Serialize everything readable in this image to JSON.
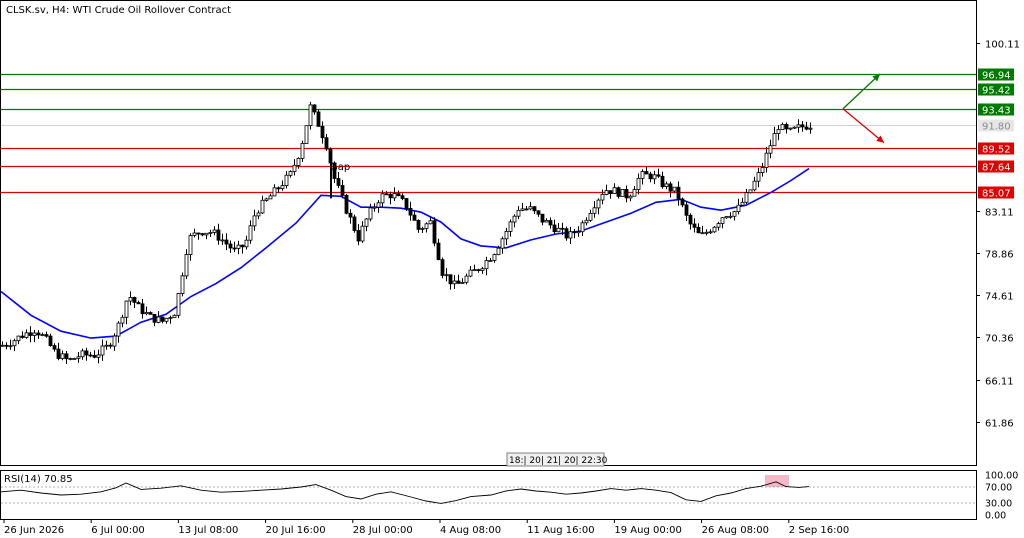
{
  "header": {
    "title": "CLSK.sv, H4:  WTI Crude Oil Rollover Contract"
  },
  "colors": {
    "candle": "#000000",
    "ma": "#0000ff",
    "resistance": "#007a00",
    "support": "#e00000",
    "current_price": "#c0c0c0",
    "rsi_line": "#000000",
    "rsi_highlight": "#f4a6b8"
  },
  "annotations": {
    "gap_label": "Gap"
  },
  "scroll_label": "18:| 20| 21| 20| 22:30",
  "chart_data": [
    {
      "type": "candlestick",
      "y_ticks": [
        "100.11",
        "83.11",
        "78.86",
        "74.61",
        "70.36",
        "66.11",
        "61.86"
      ],
      "x_labels": [
        "26 Jun 2026",
        "6 Jul 00:00",
        "13 Jul 08:00",
        "20 Jul 16:00",
        "28 Jul 00:00",
        "4 Aug 08:00",
        "11 Aug 16:00",
        "19 Aug 00:00",
        "26 Aug 08:00",
        "2 Sep 16:00"
      ],
      "ylim": [
        57.5,
        104.3
      ],
      "levels": [
        {
          "value": 96.94,
          "label": "96.94",
          "kind": "resistance"
        },
        {
          "value": 95.42,
          "label": "95.42",
          "kind": "resistance"
        },
        {
          "value": 93.43,
          "label": "93.43",
          "kind": "resistance"
        },
        {
          "value": 91.8,
          "label": "91.80",
          "kind": "current"
        },
        {
          "value": 89.52,
          "label": "89.52",
          "kind": "support"
        },
        {
          "value": 87.64,
          "label": "87.64",
          "kind": "support"
        },
        {
          "value": 85.07,
          "label": "85.07",
          "kind": "support"
        }
      ],
      "price_path": [
        [
          0,
          69.5
        ],
        [
          12,
          70.0
        ],
        [
          22,
          70.6
        ],
        [
          35,
          71.2
        ],
        [
          45,
          70.2
        ],
        [
          55,
          68.8
        ],
        [
          68,
          68.0
        ],
        [
          80,
          68.6
        ],
        [
          95,
          68.6
        ],
        [
          108,
          69.5
        ],
        [
          118,
          71.6
        ],
        [
          128,
          74.7
        ],
        [
          138,
          73.4
        ],
        [
          150,
          72.4
        ],
        [
          162,
          72.0
        ],
        [
          175,
          73.0
        ],
        [
          188,
          80.3
        ],
        [
          200,
          81.1
        ],
        [
          212,
          81.0
        ],
        [
          222,
          80.2
        ],
        [
          235,
          79.0
        ],
        [
          245,
          79.8
        ],
        [
          255,
          83.0
        ],
        [
          268,
          84.4
        ],
        [
          280,
          85.7
        ],
        [
          290,
          86.8
        ],
        [
          300,
          89.3
        ],
        [
          310,
          93.6
        ],
        [
          318,
          91.9
        ],
        [
          326,
          89.8
        ],
        [
          334,
          86.4
        ],
        [
          345,
          83.5
        ],
        [
          358,
          80.4
        ],
        [
          368,
          82.7
        ],
        [
          380,
          84.6
        ],
        [
          392,
          84.8
        ],
        [
          405,
          83.8
        ],
        [
          418,
          81.3
        ],
        [
          430,
          82.0
        ],
        [
          442,
          77.0
        ],
        [
          455,
          75.5
        ],
        [
          468,
          76.6
        ],
        [
          480,
          77.5
        ],
        [
          492,
          78.7
        ],
        [
          505,
          80.9
        ],
        [
          518,
          83.4
        ],
        [
          530,
          83.3
        ],
        [
          542,
          82.2
        ],
        [
          555,
          81.4
        ],
        [
          568,
          80.5
        ],
        [
          580,
          81.5
        ],
        [
          592,
          83.6
        ],
        [
          604,
          85.3
        ],
        [
          616,
          85.1
        ],
        [
          628,
          84.6
        ],
        [
          640,
          86.7
        ],
        [
          652,
          86.7
        ],
        [
          664,
          85.7
        ],
        [
          676,
          85.0
        ],
        [
          688,
          82.0
        ],
        [
          700,
          80.5
        ],
        [
          712,
          81.5
        ],
        [
          724,
          82.8
        ],
        [
          736,
          83.1
        ],
        [
          748,
          84.9
        ],
        [
          760,
          87.1
        ],
        [
          770,
          89.8
        ],
        [
          778,
          91.7
        ],
        [
          788,
          91.0
        ],
        [
          798,
          91.5
        ],
        [
          808,
          91.8
        ]
      ],
      "moving_average": [
        [
          0,
          75.0
        ],
        [
          30,
          72.6
        ],
        [
          60,
          71.0
        ],
        [
          90,
          70.3
        ],
        [
          115,
          70.5
        ],
        [
          140,
          71.9
        ],
        [
          165,
          72.7
        ],
        [
          190,
          74.5
        ],
        [
          215,
          75.8
        ],
        [
          240,
          77.4
        ],
        [
          265,
          79.4
        ],
        [
          295,
          81.9
        ],
        [
          320,
          84.7
        ],
        [
          340,
          84.6
        ],
        [
          360,
          83.5
        ],
        [
          380,
          83.5
        ],
        [
          400,
          83.4
        ],
        [
          420,
          83.0
        ],
        [
          440,
          82.0
        ],
        [
          460,
          80.3
        ],
        [
          480,
          79.6
        ],
        [
          505,
          79.4
        ],
        [
          530,
          80.2
        ],
        [
          555,
          80.8
        ],
        [
          580,
          81.1
        ],
        [
          605,
          82.0
        ],
        [
          630,
          82.9
        ],
        [
          655,
          84.0
        ],
        [
          680,
          84.3
        ],
        [
          700,
          83.5
        ],
        [
          720,
          83.2
        ],
        [
          745,
          83.7
        ],
        [
          770,
          85.0
        ],
        [
          790,
          86.2
        ],
        [
          808,
          87.4
        ]
      ],
      "gap_marker": {
        "x": 330,
        "value": 86.8
      },
      "scenarios": [
        {
          "kind": "bullish",
          "from": [
            843,
            93.43
          ],
          "to": [
            880,
            96.94
          ]
        },
        {
          "kind": "bearish",
          "from": [
            843,
            93.43
          ],
          "to": [
            884,
            90.0
          ]
        }
      ]
    },
    {
      "type": "line",
      "title": "RSI(14) 70.85",
      "y_ticks": [
        "100.00",
        "70.00",
        "30.00",
        "0.00"
      ],
      "ylim": [
        0,
        100
      ],
      "levels": [
        70,
        30
      ],
      "values": [
        [
          0,
          58
        ],
        [
          20,
          62
        ],
        [
          40,
          55
        ],
        [
          60,
          50
        ],
        [
          80,
          52
        ],
        [
          100,
          58
        ],
        [
          115,
          68
        ],
        [
          125,
          80
        ],
        [
          140,
          64
        ],
        [
          160,
          67
        ],
        [
          180,
          73
        ],
        [
          200,
          62
        ],
        [
          220,
          57
        ],
        [
          240,
          59
        ],
        [
          260,
          62
        ],
        [
          280,
          65
        ],
        [
          300,
          70
        ],
        [
          315,
          76
        ],
        [
          330,
          62
        ],
        [
          345,
          46
        ],
        [
          360,
          40
        ],
        [
          375,
          52
        ],
        [
          390,
          58
        ],
        [
          410,
          45
        ],
        [
          425,
          35
        ],
        [
          440,
          29
        ],
        [
          455,
          36
        ],
        [
          470,
          46
        ],
        [
          490,
          50
        ],
        [
          505,
          60
        ],
        [
          520,
          65
        ],
        [
          535,
          60
        ],
        [
          550,
          57
        ],
        [
          565,
          52
        ],
        [
          580,
          55
        ],
        [
          595,
          60
        ],
        [
          610,
          66
        ],
        [
          625,
          62
        ],
        [
          640,
          66
        ],
        [
          655,
          62
        ],
        [
          670,
          56
        ],
        [
          685,
          38
        ],
        [
          700,
          34
        ],
        [
          715,
          48
        ],
        [
          730,
          55
        ],
        [
          745,
          66
        ],
        [
          760,
          72
        ],
        [
          775,
          83
        ],
        [
          785,
          71
        ],
        [
          798,
          69
        ],
        [
          808,
          71
        ]
      ],
      "highlight": {
        "x_start": 764,
        "x_end": 788
      }
    }
  ]
}
